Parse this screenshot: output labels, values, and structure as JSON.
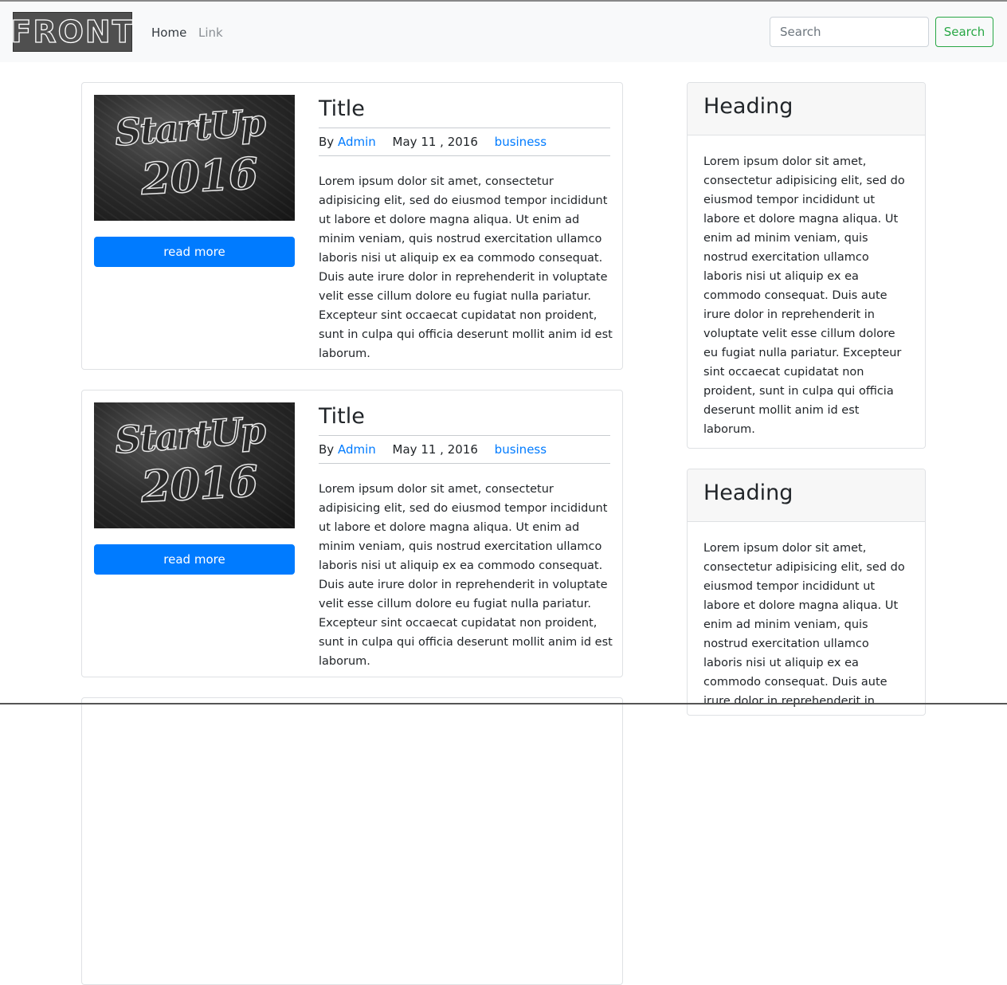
{
  "navbar": {
    "logo_text": "FRONT",
    "links": [
      {
        "label": "Home",
        "active": true
      },
      {
        "label": "Link",
        "active": false
      }
    ],
    "search": {
      "placeholder": "Search",
      "button_label": "Search"
    }
  },
  "posts": [
    {
      "image_text_line1": "StartUp",
      "image_text_line2": "2016",
      "button_label": "read more",
      "title": "Title",
      "meta": {
        "by": "By",
        "author": "Admin",
        "date": "May 11 , 2016",
        "category": "business"
      },
      "body": "Lorem ipsum dolor sit amet, consectetur adipisicing elit, sed do eiusmod tempor incididunt ut labore et dolore magna aliqua. Ut enim ad minim veniam, quis nostrud exercitation ullamco laboris nisi ut aliquip ex ea commodo consequat. Duis aute irure dolor in reprehenderit in voluptate velit esse cillum dolore eu fugiat nulla pariatur. Excepteur sint occaecat cupidatat non proident, sunt in culpa qui officia deserunt mollit anim id est laborum."
    },
    {
      "image_text_line1": "StartUp",
      "image_text_line2": "2016",
      "button_label": "read more",
      "title": "Title",
      "meta": {
        "by": "By",
        "author": "Admin",
        "date": "May 11 , 2016",
        "category": "business"
      },
      "body": "Lorem ipsum dolor sit amet, consectetur adipisicing elit, sed do eiusmod tempor incididunt ut labore et dolore magna aliqua. Ut enim ad minim veniam, quis nostrud exercitation ullamco laboris nisi ut aliquip ex ea commodo consequat. Duis aute irure dolor in reprehenderit in voluptate velit esse cillum dolore eu fugiat nulla pariatur. Excepteur sint occaecat cupidatat non proident, sunt in culpa qui officia deserunt mollit anim id est laborum."
    }
  ],
  "sidebar": [
    {
      "heading": "Heading",
      "body": "Lorem ipsum dolor sit amet, consectetur adipisicing elit, sed do eiusmod tempor incididunt ut labore et dolore magna aliqua. Ut enim ad minim veniam, quis nostrud exercitation ullamco laboris nisi ut aliquip ex ea commodo consequat. Duis aute irure dolor in reprehenderit in voluptate velit esse cillum dolore eu fugiat nulla pariatur. Excepteur sint occaecat cupidatat non proident, sunt in culpa qui officia deserunt mollit anim id est laborum."
    },
    {
      "heading": "Heading",
      "body": "Lorem ipsum dolor sit amet, consectetur adipisicing elit, sed do eiusmod tempor incididunt ut labore et dolore magna aliqua. Ut enim ad minim veniam, quis nostrud exercitation ullamco laboris nisi ut aliquip ex ea commodo consequat. Duis aute irure dolor in reprehenderit in voluptate velit esse cillum dolore eu fugiat nulla pariatur. Excepteur sint occaecat cupidatat non proident, sunt in culpa qui officia deserunt mollit anim id est laborum."
    }
  ],
  "colors": {
    "primary": "#007bff",
    "success": "#28a745",
    "navbar_bg": "#f8f9fa",
    "card_header_bg": "#f7f7f7"
  }
}
